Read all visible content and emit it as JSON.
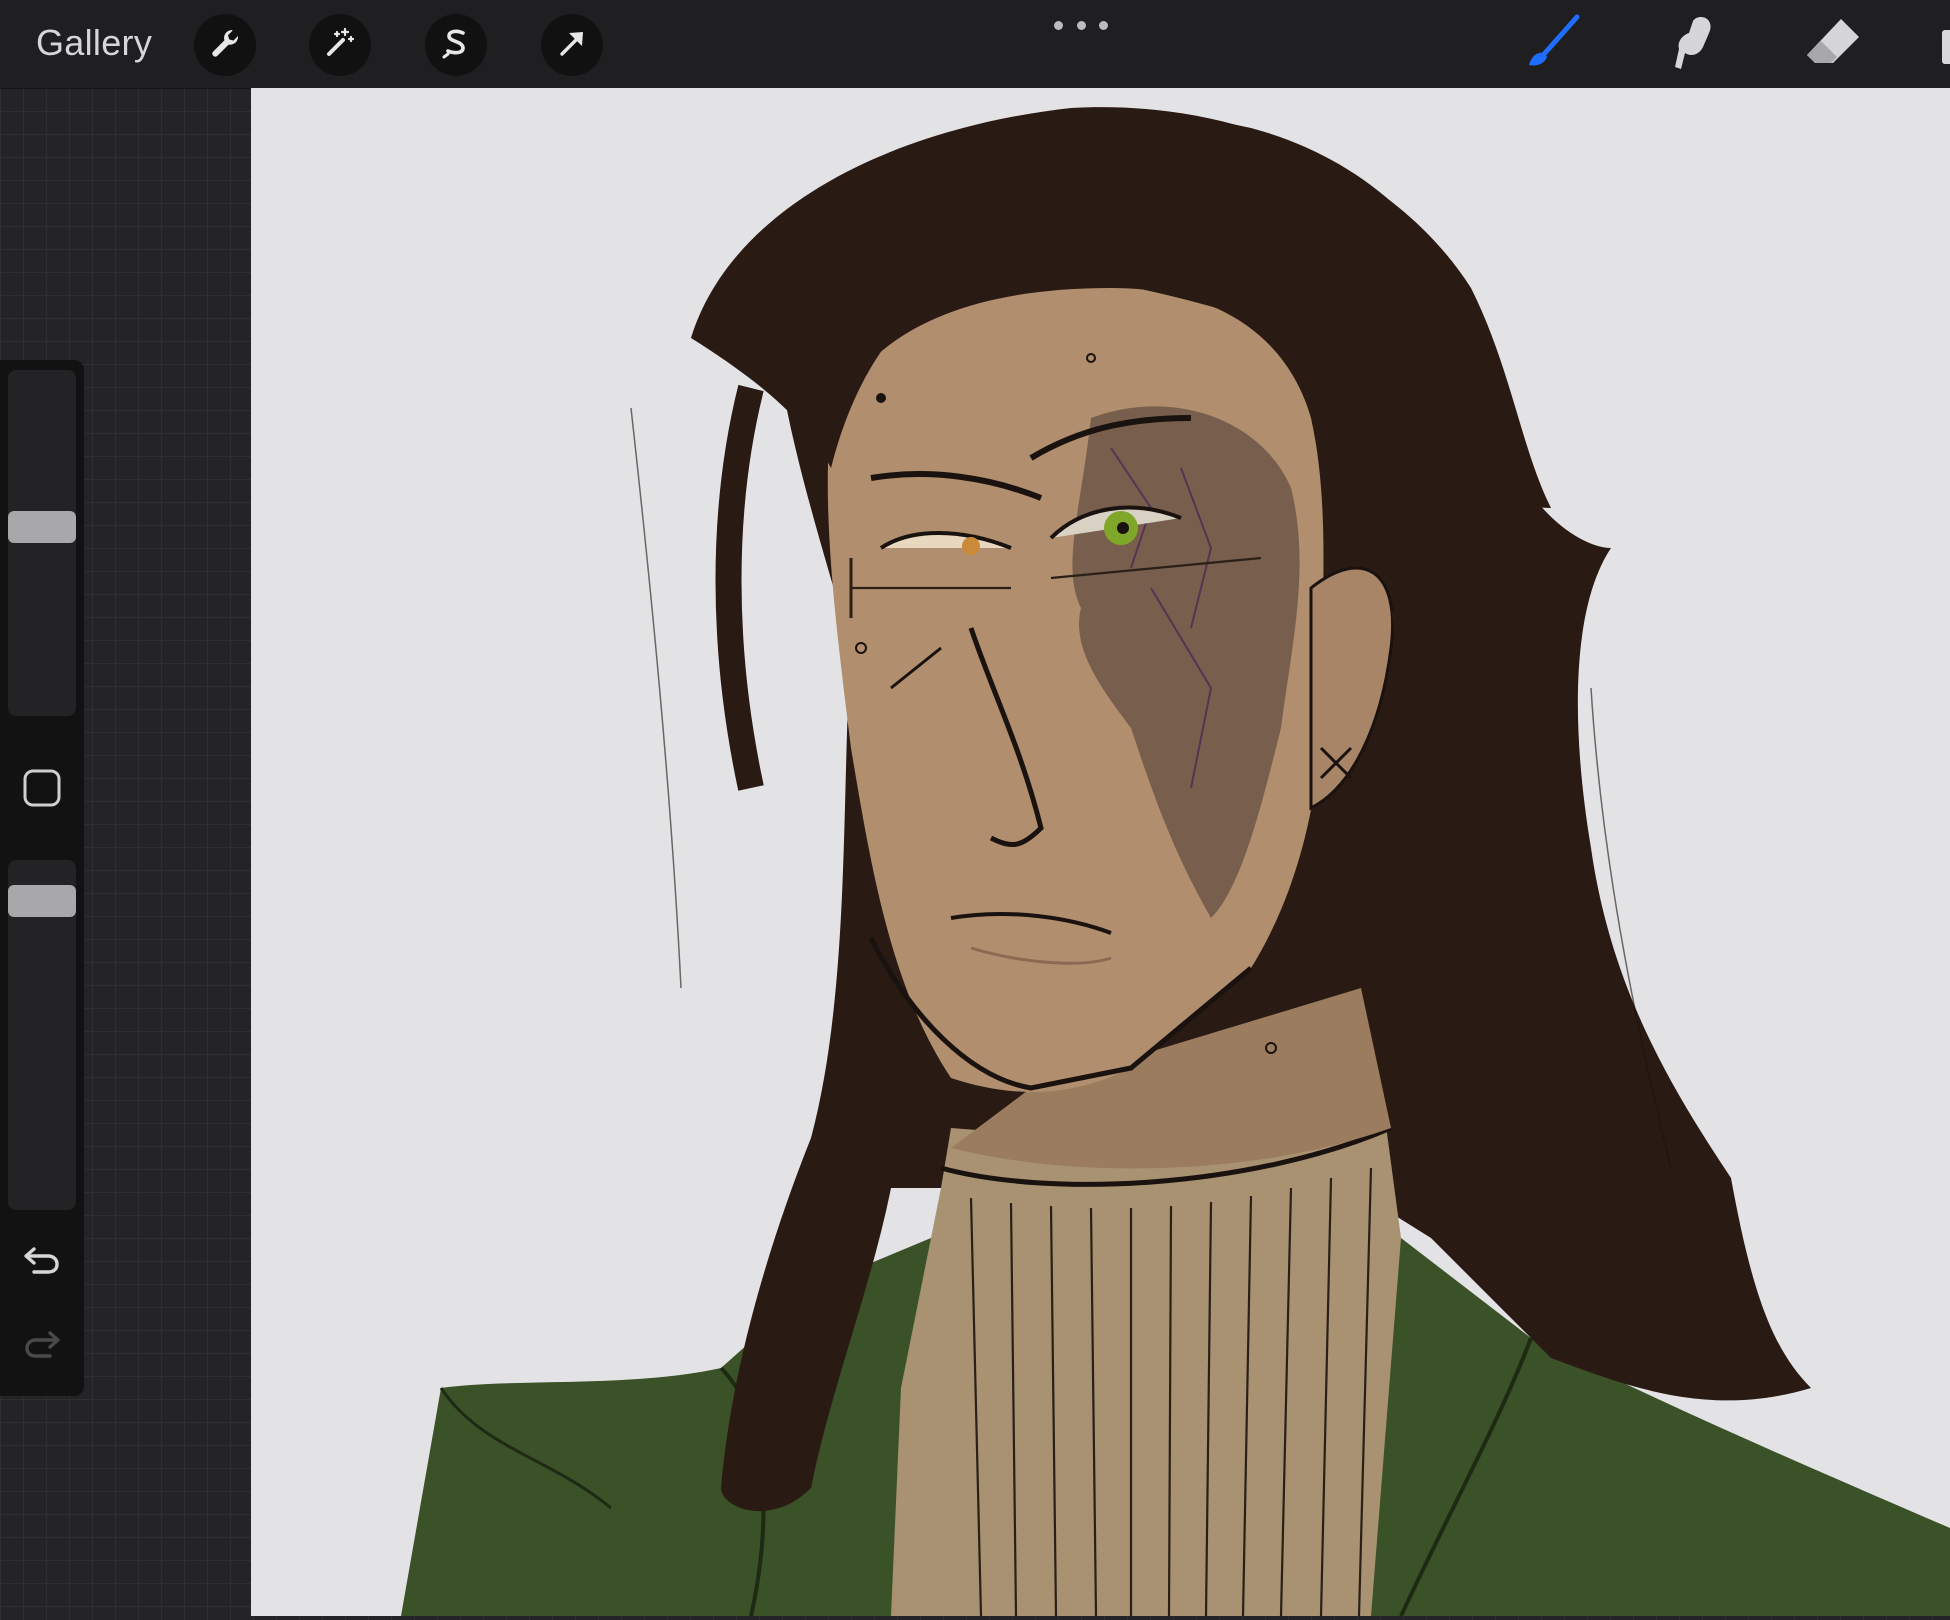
{
  "app": {
    "gallery_label": "Gallery"
  },
  "toolbar_left": [
    {
      "name": "actions-wrench",
      "icon": "wrench-icon"
    },
    {
      "name": "adjustments",
      "icon": "magic-wand-icon"
    },
    {
      "name": "selection",
      "icon": "selection-s-icon"
    },
    {
      "name": "transform",
      "icon": "arrow-cursor-icon"
    }
  ],
  "toolbar_right": [
    {
      "name": "brush",
      "icon": "brush-icon",
      "active": true,
      "color": "#1f6dff"
    },
    {
      "name": "smudge",
      "icon": "smudge-finger-icon",
      "active": false
    },
    {
      "name": "eraser",
      "icon": "eraser-icon",
      "active": false
    }
  ],
  "sidebar": {
    "brush_size_level": 0.55,
    "opacity_level": 0.92
  },
  "colors": {
    "canvas_bg": "#e3e3e5",
    "hair": "#2a1a14",
    "skin": "#b08e6e",
    "sweater": "#a89272",
    "jacket": "#3b5228",
    "eye": "#7fa82a"
  }
}
